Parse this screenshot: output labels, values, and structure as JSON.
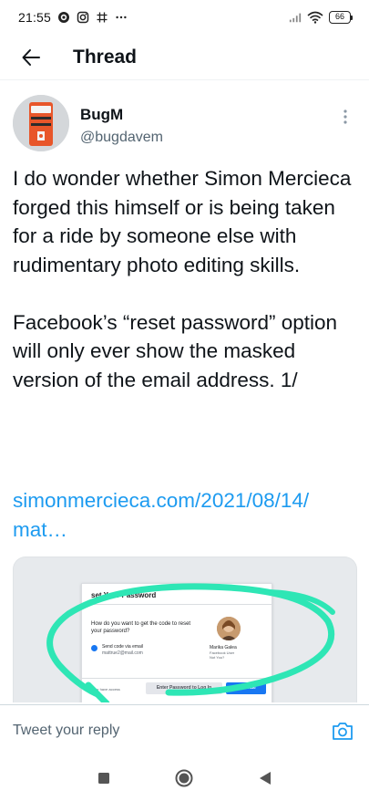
{
  "status_bar": {
    "time": "21:55",
    "battery": "66",
    "icons": [
      "whatsapp-icon",
      "instagram-icon",
      "hashtag-icon",
      "more-dots-icon",
      "signal-icon",
      "wifi-icon",
      "battery-icon"
    ]
  },
  "header": {
    "title": "Thread",
    "back_icon": "arrow-left-icon"
  },
  "tweet": {
    "author_name": "BugM",
    "author_handle": "@bugdavem",
    "text": "I do wonder whether Simon Mercieca forged this himself or is being taken for a ride by someone else with rudimentary photo editing skills.\n\nFacebook’s “reset password” option will only ever show the masked version of the email address. 1/",
    "link": "simonmercieca.com/2021/08/14/\nmat…"
  },
  "card": {
    "title": "set Your Password",
    "question": "How do you want to get the code to reset your password?",
    "option_label": "Send code via email",
    "option_value": "mattrue2@mail.com",
    "profile_name": "Marika Galea",
    "profile_sub": "Facebook User\nNot You?",
    "no_access": "o longer have access",
    "secondary_button": "Enter Password to Log In",
    "primary_button": "Continue",
    "highlight_color": "#2ee6b5"
  },
  "reply": {
    "placeholder": "Tweet your reply"
  },
  "colors": {
    "link": "#1d9bf0",
    "muted": "#536471",
    "text": "#0f1419"
  }
}
